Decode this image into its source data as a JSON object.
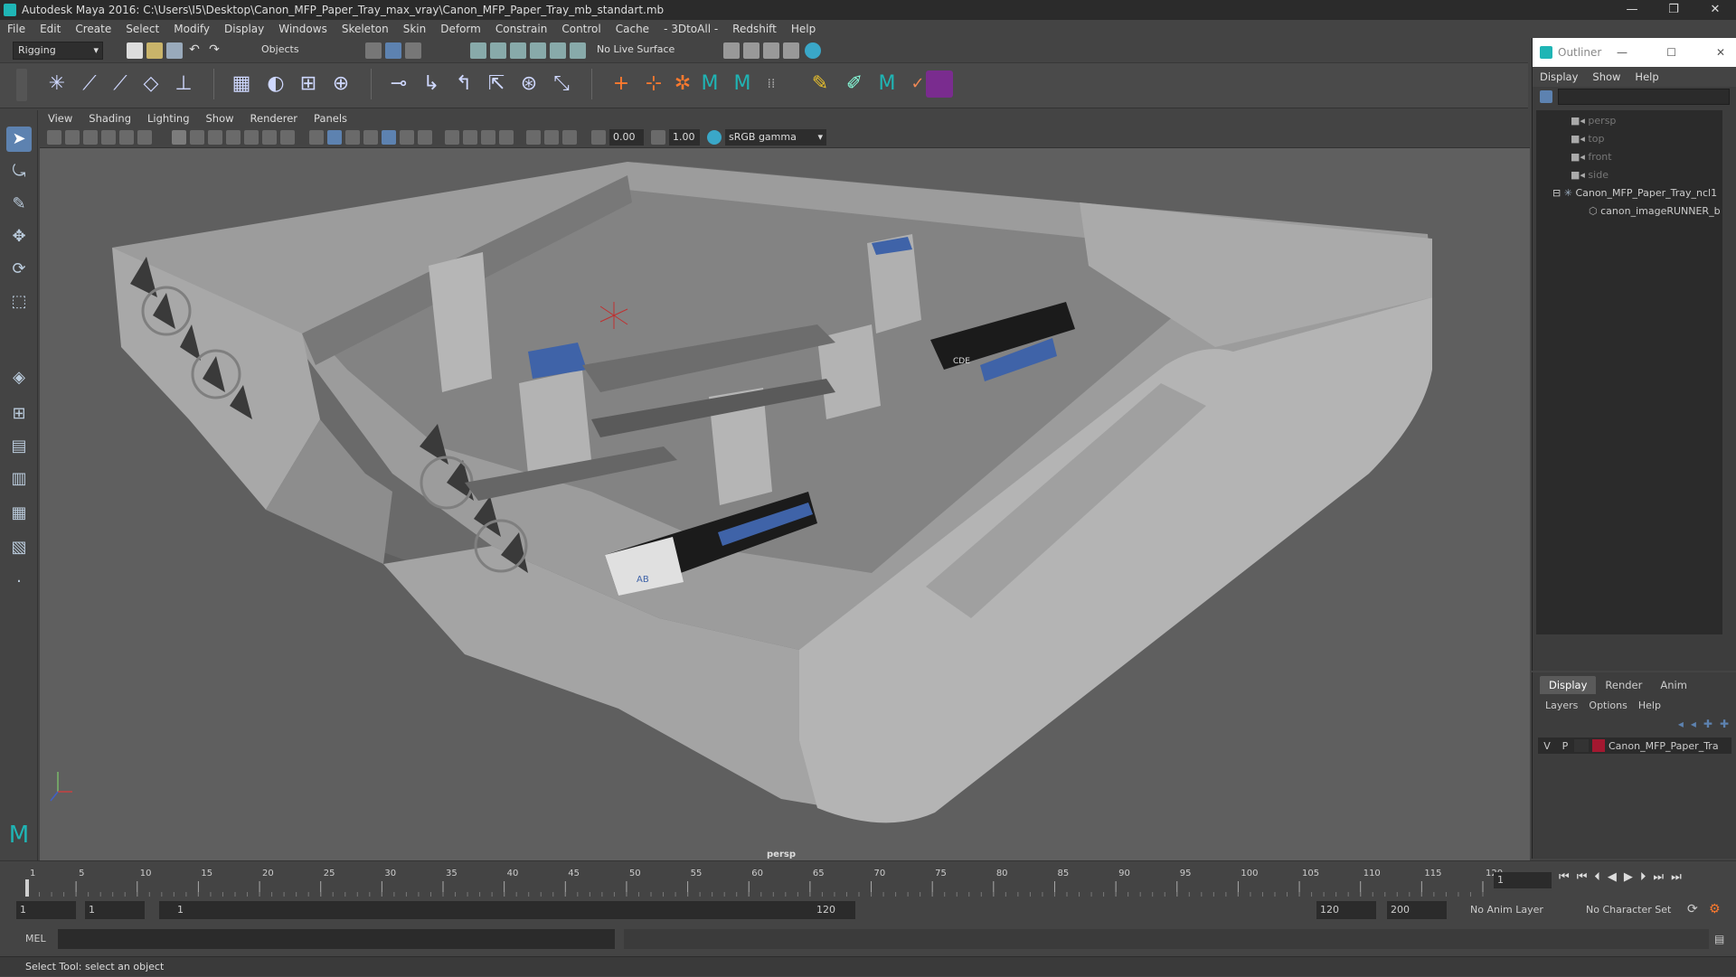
{
  "app": {
    "title": "Autodesk Maya 2016: C:\\Users\\I5\\Desktop\\Canon_MFP_Paper_Tray_max_vray\\Canon_MFP_Paper_Tray_mb_standart.mb",
    "window_controls": [
      "—",
      "❐",
      "✕"
    ]
  },
  "menubar": [
    "File",
    "Edit",
    "Create",
    "Select",
    "Modify",
    "Display",
    "Windows",
    "Skeleton",
    "Skin",
    "Deform",
    "Constrain",
    "Control",
    "Cache",
    "- 3DtoAll -",
    "Redshift",
    "Help"
  ],
  "status": {
    "menuset": "Rigging",
    "select_mode": "Objects",
    "live_surface": "No Live Surface"
  },
  "viewport": {
    "menu": [
      "View",
      "Shading",
      "Lighting",
      "Show",
      "Renderer",
      "Panels"
    ],
    "exposure": "0.00",
    "gamma": "1.00",
    "colorspace": "sRGB gamma",
    "camera_label": "persp",
    "label_text": {
      "label1": "AB",
      "label2": "CDE"
    }
  },
  "outliner": {
    "title": "Outliner",
    "menu": [
      "Display",
      "Show",
      "Help"
    ],
    "items": [
      {
        "name": "persp",
        "icon": "camera-icon"
      },
      {
        "name": "top",
        "icon": "camera-icon"
      },
      {
        "name": "front",
        "icon": "camera-icon"
      },
      {
        "name": "side",
        "icon": "camera-icon"
      },
      {
        "name": "Canon_MFP_Paper_Tray_ncl1",
        "icon": "group-icon"
      },
      {
        "name": "canon_imageRUNNER_b",
        "icon": "mesh-icon"
      }
    ]
  },
  "layers": {
    "tabs": [
      "Display",
      "Render",
      "Anim"
    ],
    "menu": [
      "Layers",
      "Options",
      "Help"
    ],
    "layer": {
      "v": "V",
      "p": "P",
      "name": "Canon_MFP_Paper_Tra",
      "color": "#a31830"
    }
  },
  "timeline": {
    "ticks": [
      "1",
      "5",
      "10",
      "15",
      "20",
      "25",
      "30",
      "35",
      "40",
      "45",
      "50",
      "55",
      "60",
      "65",
      "70",
      "75",
      "80",
      "85",
      "90",
      "95",
      "100",
      "105",
      "110",
      "115",
      "120"
    ],
    "current_frame": "1"
  },
  "range": {
    "start": "1",
    "inner_start": "1",
    "slider_start": "1",
    "slider_end": "120",
    "end": "120",
    "max": "200",
    "anim_layer": "No Anim Layer",
    "char_set": "No Character Set"
  },
  "cmd": {
    "lang": "MEL"
  },
  "help_text": "Select Tool: select an object"
}
